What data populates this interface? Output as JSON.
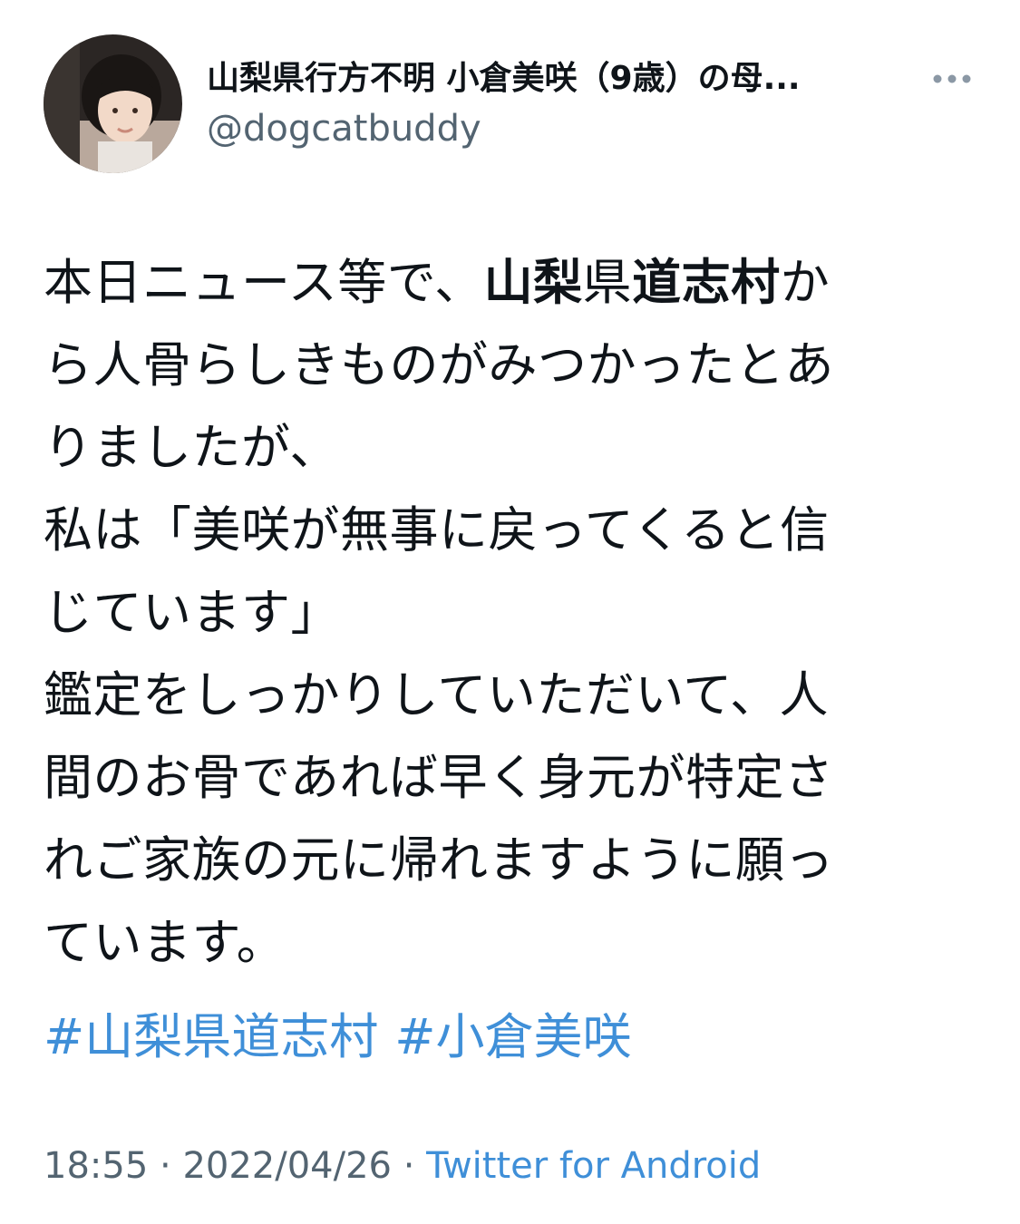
{
  "user": {
    "display_name": "山梨県行方不明 小倉美咲（9歳）の母...",
    "handle": "@dogcatbuddy"
  },
  "more_icon": "more-horizontal-icon",
  "tweet": {
    "lines": [
      [
        {
          "text": "本日ニュース等で、"
        },
        {
          "text": "山梨",
          "bold": true
        },
        {
          "text": "県"
        },
        {
          "text": "道志村",
          "bold": true
        },
        {
          "text": "か"
        }
      ],
      [
        {
          "text": "ら人骨らしきものがみつかったとあ"
        }
      ],
      [
        {
          "text": "りましたが、"
        }
      ],
      [
        {
          "text": "私は「美咲が無事に戻ってくると信"
        }
      ],
      [
        {
          "text": "じています」"
        }
      ],
      [
        {
          "text": "鑑定をしっかりしていただいて、人"
        }
      ],
      [
        {
          "text": "間のお骨であれば早く身元が特定さ"
        }
      ],
      [
        {
          "text": "れご家族の元に帰れますように願っ"
        }
      ],
      [
        {
          "text": "ています。"
        }
      ]
    ],
    "hashtags": [
      "#山梨県道志村",
      "#小倉美咲"
    ]
  },
  "meta": {
    "time": "18:55",
    "date": "2022/04/26",
    "separator": " · ",
    "source": "Twitter for Android"
  },
  "colors": {
    "text": "#0f1419",
    "secondary": "#536471",
    "link": "#3f8fd8"
  }
}
